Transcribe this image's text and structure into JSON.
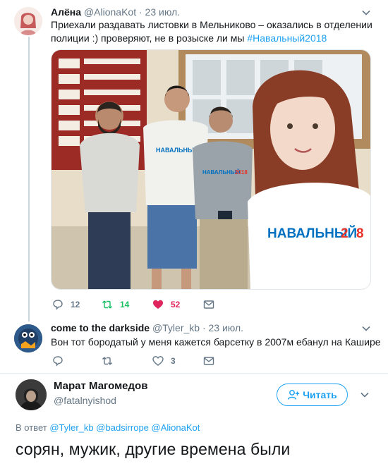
{
  "tweet1": {
    "name": "Алёна",
    "handle": "@AlionaKot",
    "separator": "·",
    "date": "23 июл.",
    "text_line1": "Приехали раздавать листовки в Мельниково – оказались в отделении",
    "text_line2": "полиции :) проверяют, не в розыске ли мы ",
    "hashtag": "#Навальный2018",
    "photo": {
      "shirt_text": "НАВАЛЬНЫЙ",
      "shirt_year_prefix": "2",
      "shirt_year_suffix": "8",
      "accent_red": "#e8332a",
      "accent_blue": "#0070c0"
    },
    "actions": {
      "reply_count": "12",
      "retweet_count": "14",
      "like_count": "52"
    }
  },
  "tweet2": {
    "name": "come to the darkside",
    "handle": "@Tyler_kb",
    "separator": "·",
    "date": "23 июл.",
    "text": "Вон тот бородатый у меня кажется барсетку в 2007м ебанул на Кашире",
    "actions": {
      "reply_count": "",
      "retweet_count": "",
      "like_count": "3"
    }
  },
  "tweet3": {
    "name": "Марат Магомедов",
    "handle": "@fatalnyishod",
    "follow_label": "Читать",
    "reply_prefix": "В ответ",
    "mentions": [
      "@Tyler_kb",
      "@badsirrope",
      "@AlionaKot"
    ],
    "text": "сорян, мужик, другие времена были"
  },
  "colors": {
    "accent": "#1da1f2",
    "secondary_text": "#657786",
    "retweet_green": "#17bf63",
    "like_red": "#e0245e"
  }
}
